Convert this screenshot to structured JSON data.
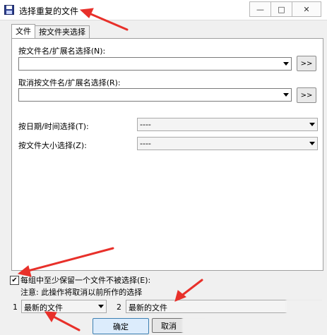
{
  "window": {
    "title": "选择重复的文件",
    "controls": [
      "—",
      "□",
      "✕"
    ]
  },
  "tabs": [
    "文件",
    "按文件夹选择"
  ],
  "fields": {
    "by_name_label": "按文件名/扩展名选择(N):",
    "by_name_value": "",
    "by_name_more": ">>",
    "cancel_name_label": "取消按文件名/扩展名选择(R):",
    "cancel_name_value": "",
    "cancel_name_more": ">>",
    "by_date_label": "按日期/时间选择(T):",
    "by_date_value": "----",
    "by_size_label": "按文件大小选择(Z):",
    "by_size_value": "----"
  },
  "keep_one": {
    "checked": true,
    "label": "每组中至少保留一个文件不被选择(E):",
    "note": "注意: 此操作将取消以前所作的选择"
  },
  "criteria": {
    "one_num": "1",
    "one_value": "最新的文件",
    "two_num": "2",
    "two_value": "最新的文件"
  },
  "buttons": {
    "ok": "确定",
    "cancel": "取消"
  },
  "colors": {
    "annotation_arrow": "#e8302a"
  }
}
